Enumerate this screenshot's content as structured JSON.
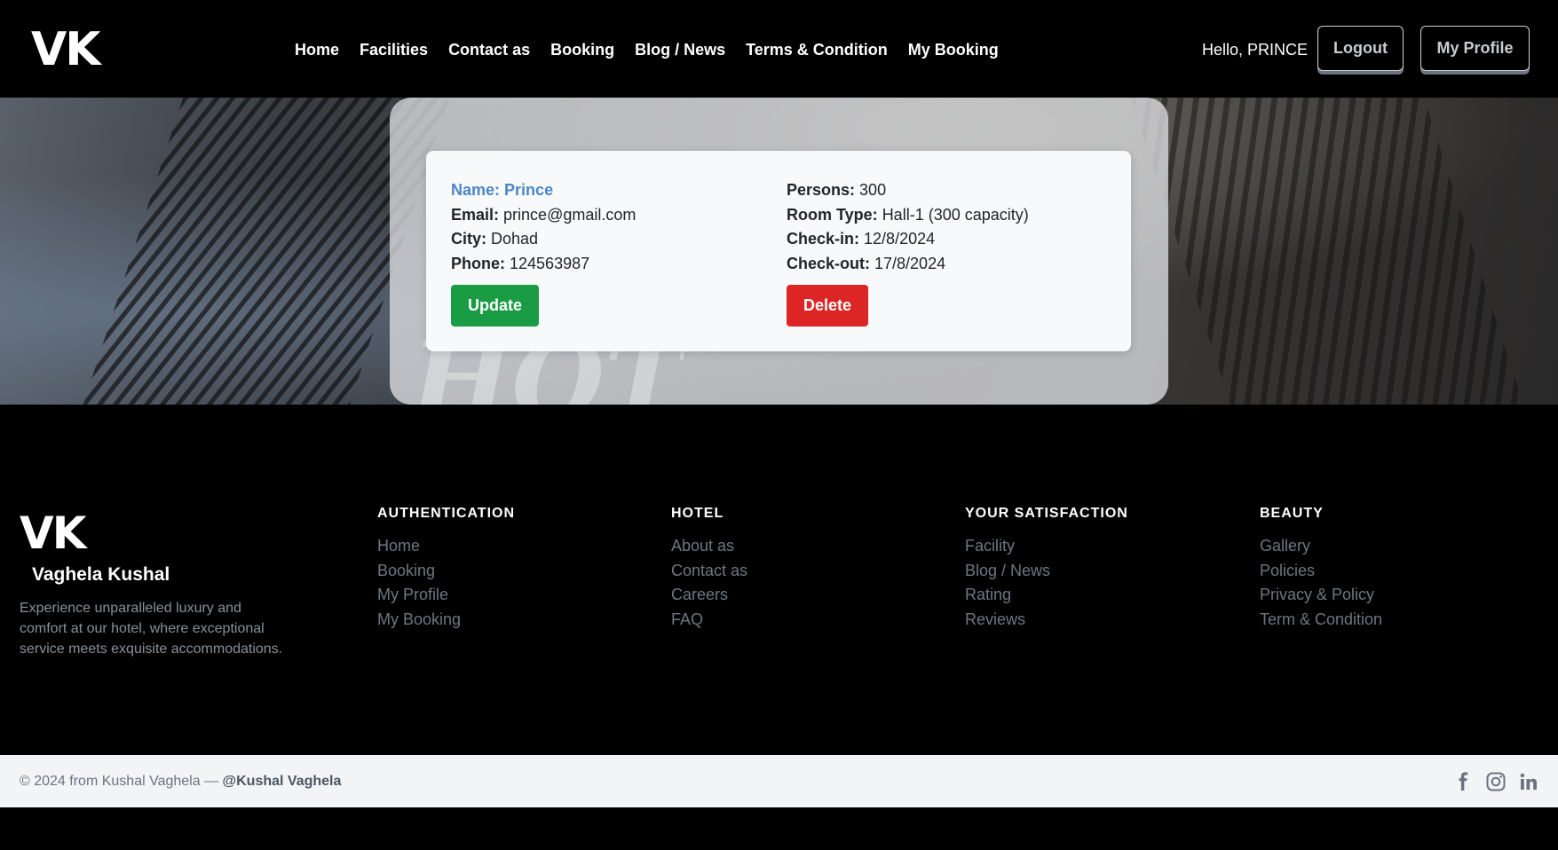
{
  "header": {
    "logo": "VK",
    "nav": [
      "Home",
      "Facilities",
      "Contact as",
      "Booking",
      "Blog / News",
      "Terms & Condition",
      "My Booking"
    ],
    "greeting": "Hello, PRINCE",
    "logout_label": "Logout",
    "profile_label": "My Profile"
  },
  "booking": {
    "name_label": "Name:",
    "name": "Prince",
    "email_label": "Email:",
    "email": "prince@gmail.com",
    "city_label": "City:",
    "city": "Dohad",
    "phone_label": "Phone:",
    "phone": "124563987",
    "persons_label": "Persons:",
    "persons": "300",
    "room_type_label": "Room Type:",
    "room_type": "Hall-1 (300 capacity)",
    "checkin_label": "Check-in:",
    "checkin": "12/8/2024",
    "checkout_label": "Check-out:",
    "checkout": "17/8/2024",
    "update_label": "Update",
    "delete_label": "Delete"
  },
  "footer": {
    "logo": "VK",
    "name": "Vaghela Kushal",
    "description": "Experience unparalleled luxury and comfort at our hotel, where exceptional service meets exquisite accommodations.",
    "columns": [
      {
        "title": "AUTHENTICATION",
        "links": [
          "Home",
          "Booking",
          "My Profile",
          "My Booking"
        ]
      },
      {
        "title": "HOTEL",
        "links": [
          "About as",
          "Contact as",
          "Careers",
          "FAQ"
        ]
      },
      {
        "title": "YOUR SATISFACTION",
        "links": [
          "Facility",
          "Blog / News",
          "Rating",
          "Reviews"
        ]
      },
      {
        "title": "BEAUTY",
        "links": [
          "Gallery",
          "Policies",
          "Privacy & Policy",
          "Term & Condition"
        ]
      }
    ]
  },
  "bottom": {
    "copyright": "© 2024 from Kushal Vaghela —",
    "handle": "@Kushal Vaghela",
    "socials": [
      "facebook-icon",
      "instagram-icon",
      "linkedin-icon"
    ]
  },
  "colors": {
    "update": "#1a9c45",
    "delete": "#dc2626",
    "name_accent": "#4a86c8"
  }
}
